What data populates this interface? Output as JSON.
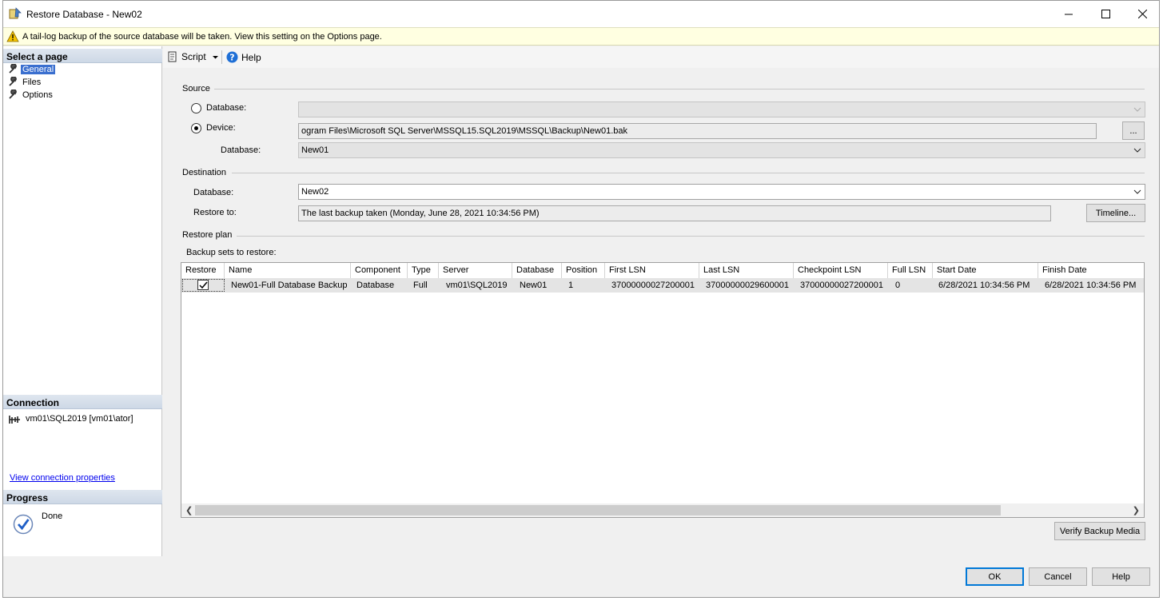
{
  "window": {
    "title": "Restore Database - New02"
  },
  "infobar": {
    "message": "A tail-log backup of the source database will be taken. View this setting on the Options page."
  },
  "left": {
    "select_header": "Select a page",
    "pages": [
      {
        "label": "General",
        "selected": true
      },
      {
        "label": "Files",
        "selected": false
      },
      {
        "label": "Options",
        "selected": false
      }
    ],
    "connection_header": "Connection",
    "connection_text": "vm01\\SQL2019 [vm01\\ator]",
    "view_link": "View connection properties",
    "progress_header": "Progress",
    "progress_status": "Done"
  },
  "toolbar": {
    "script": "Script",
    "help": "Help"
  },
  "source": {
    "legend": "Source",
    "database_radio": "Database:",
    "device_radio": "Device:",
    "device_path": "ogram Files\\Microsoft SQL Server\\MSSQL15.SQL2019\\MSSQL\\Backup\\New01.bak",
    "browse": "...",
    "database_label": "Database:",
    "database_value": "New01",
    "selected_option": "Device"
  },
  "destination": {
    "legend": "Destination",
    "database_label": "Database:",
    "database_value": "New02",
    "restore_to_label": "Restore to:",
    "restore_to_value": "The last backup taken (Monday, June 28, 2021 10:34:56 PM)",
    "timeline_button": "Timeline..."
  },
  "plan": {
    "legend": "Restore plan",
    "sets_label": "Backup sets to restore:",
    "columns": [
      "Restore",
      "Name",
      "Component",
      "Type",
      "Server",
      "Database",
      "Position",
      "First LSN",
      "Last LSN",
      "Checkpoint LSN",
      "Full LSN",
      "Start Date",
      "Finish Date"
    ],
    "rows": [
      {
        "restore": true,
        "name": "New01-Full Database Backup",
        "component": "Database",
        "type": "Full",
        "server": "vm01\\SQL2019",
        "database": "New01",
        "position": "1",
        "first_lsn": "37000000027200001",
        "last_lsn": "37000000029600001",
        "checkpoint_lsn": "37000000027200001",
        "full_lsn": "0",
        "start_date": "6/28/2021 10:34:56 PM",
        "finish_date": "6/28/2021 10:34:56 PM"
      }
    ],
    "verify_button": "Verify Backup Media"
  },
  "footer": {
    "ok": "OK",
    "cancel": "Cancel",
    "help": "Help"
  },
  "colors": {
    "selection": "#3a6fcf",
    "default_button_border": "#0078d7",
    "infobar_bg": "#ffffe1"
  }
}
